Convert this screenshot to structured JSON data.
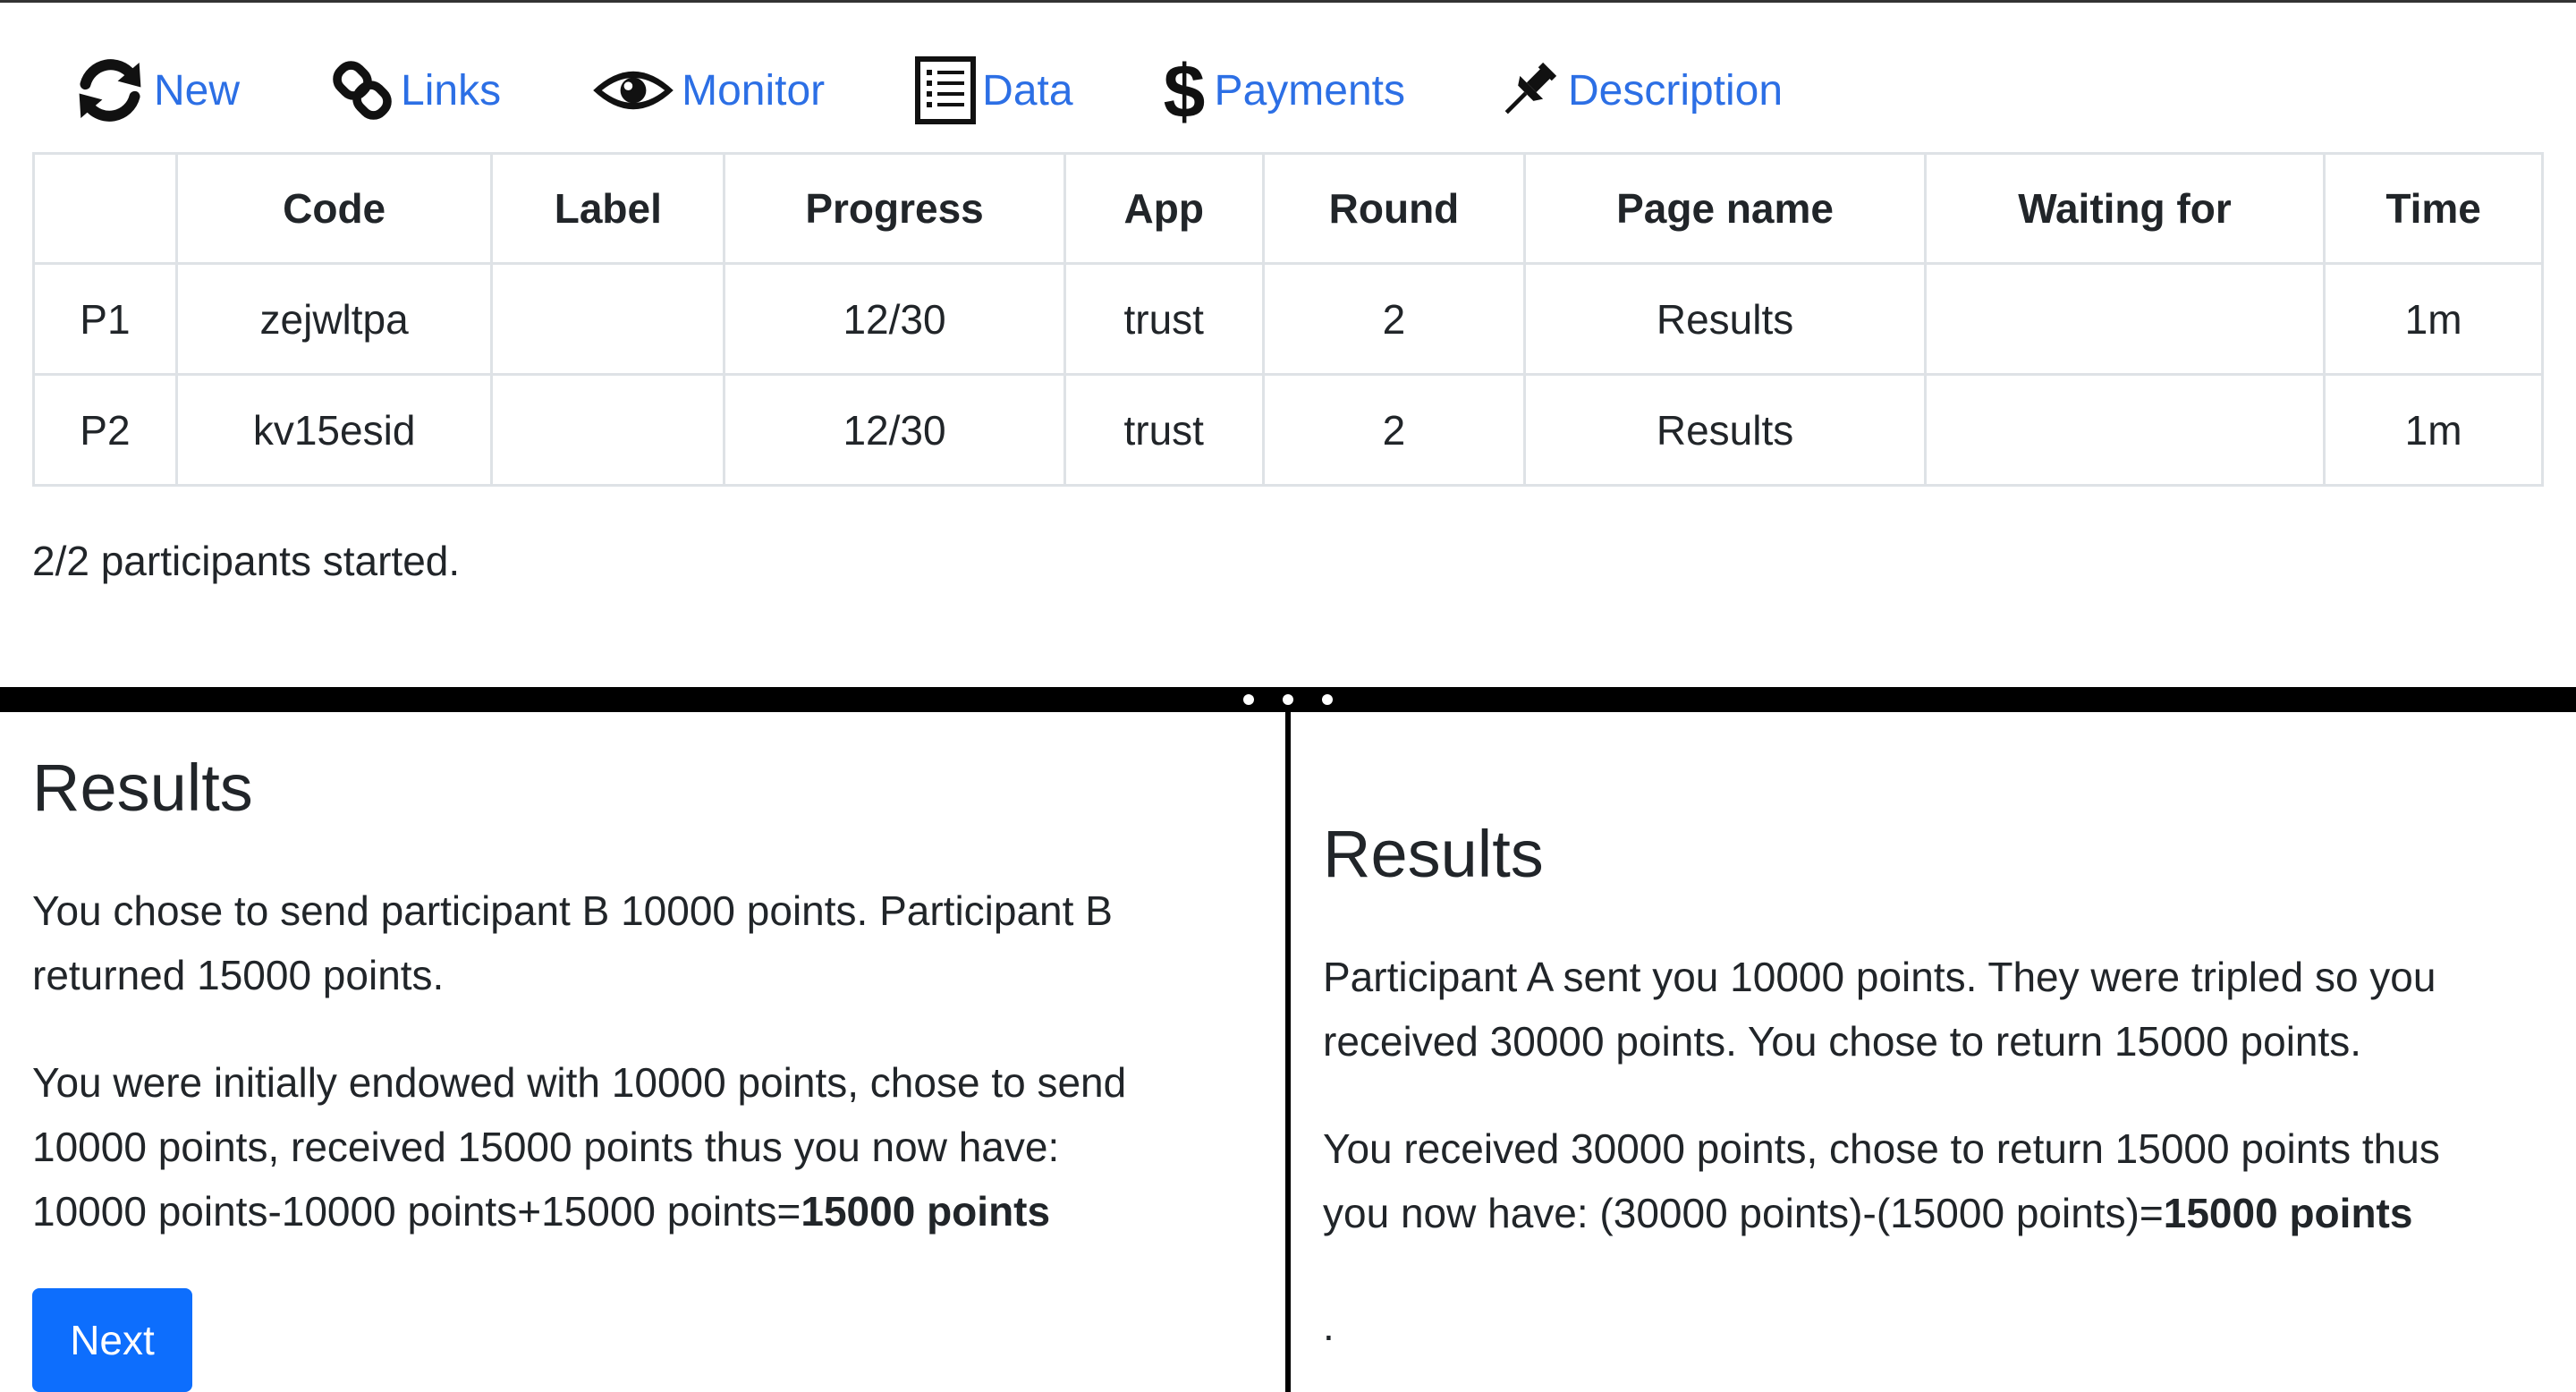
{
  "nav": {
    "items": [
      {
        "label": "New",
        "icon": "refresh-icon"
      },
      {
        "label": "Links",
        "icon": "link-icon"
      },
      {
        "label": "Monitor",
        "icon": "eye-icon"
      },
      {
        "label": "Data",
        "icon": "list-icon"
      },
      {
        "label": "Payments",
        "icon": "dollar-icon"
      },
      {
        "label": "Description",
        "icon": "pushpin-icon"
      }
    ],
    "link_color": "#2c6fe5"
  },
  "table": {
    "headers": [
      "",
      "Code",
      "Label",
      "Progress",
      "App",
      "Round",
      "Page name",
      "Waiting for",
      "Time"
    ],
    "rows": [
      [
        "P1",
        "zejwltpa",
        "",
        "12/30",
        "trust",
        "2",
        "Results",
        "",
        "1m"
      ],
      [
        "P2",
        "kv15esid",
        "",
        "12/30",
        "trust",
        "2",
        "Results",
        "",
        "1m"
      ]
    ]
  },
  "status": "2/2 participants started.",
  "left_panel": {
    "title": "Results",
    "para1": "You chose to send participant B 10000 points. Participant B returned 15000 points.",
    "para2_line1": "You were initially endowed with 10000 points, chose to send",
    "para2_line2": "10000 points, received 15000 points thus you now have:",
    "para2_line3_prefix": "10000 points-10000 points+15000 points=",
    "para2_total": "15000 points",
    "next_label": "Next",
    "button_color": "#0d6efd"
  },
  "right_panel": {
    "title": "Results",
    "para1": "Participant A sent you 10000 points. They were tripled so you received 30000 points. You chose to return 15000 points.",
    "para2_line1": "You received 30000 points, chose to return 15000 points thus",
    "para2_line2_prefix": "you now have: (30000 points)-(15000 points)=",
    "para2_total": "15000 points",
    "trailing": "."
  }
}
